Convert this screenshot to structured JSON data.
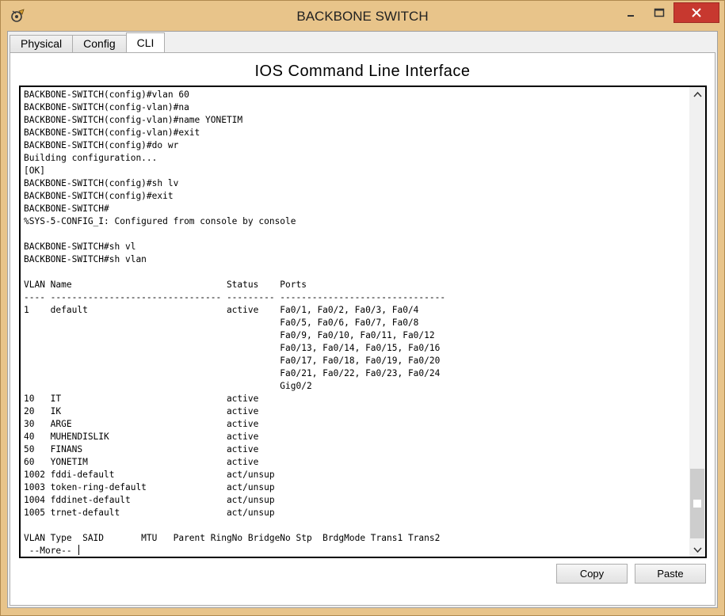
{
  "window": {
    "title": "BACKBONE SWITCH",
    "app_icon": "packet-tracer-icon",
    "controls": [
      "minimize-icon",
      "maximize-icon",
      "close-icon"
    ]
  },
  "tabs": [
    {
      "label": "Physical",
      "active": false
    },
    {
      "label": "Config",
      "active": false
    },
    {
      "label": "CLI",
      "active": true
    }
  ],
  "cli": {
    "heading": "IOS Command Line Interface",
    "lines": [
      "BACKBONE-SWITCH(config)#vlan 60",
      "BACKBONE-SWITCH(config-vlan)#na",
      "BACKBONE-SWITCH(config-vlan)#name YONETIM",
      "BACKBONE-SWITCH(config-vlan)#exit",
      "BACKBONE-SWITCH(config)#do wr",
      "Building configuration...",
      "[OK]",
      "BACKBONE-SWITCH(config)#sh lv",
      "BACKBONE-SWITCH(config)#exit",
      "BACKBONE-SWITCH#",
      "%SYS-5-CONFIG_I: Configured from console by console",
      "",
      "BACKBONE-SWITCH#sh vl",
      "BACKBONE-SWITCH#sh vlan",
      "",
      "VLAN Name                             Status    Ports",
      "---- -------------------------------- --------- -------------------------------",
      "1    default                          active    Fa0/1, Fa0/2, Fa0/3, Fa0/4",
      "                                                Fa0/5, Fa0/6, Fa0/7, Fa0/8",
      "                                                Fa0/9, Fa0/10, Fa0/11, Fa0/12",
      "                                                Fa0/13, Fa0/14, Fa0/15, Fa0/16",
      "                                                Fa0/17, Fa0/18, Fa0/19, Fa0/20",
      "                                                Fa0/21, Fa0/22, Fa0/23, Fa0/24",
      "                                                Gig0/2",
      "10   IT                               active",
      "20   IK                               active",
      "30   ARGE                             active",
      "40   MUHENDISLIK                      active",
      "50   FINANS                           active",
      "60   YONETIM                          active",
      "1002 fddi-default                     act/unsup",
      "1003 token-ring-default               act/unsup",
      "1004 fddinet-default                  act/unsup",
      "1005 trnet-default                    act/unsup",
      "",
      "VLAN Type  SAID       MTU   Parent RingNo BridgeNo Stp  BrdgMode Trans1 Trans2",
      " --More-- "
    ],
    "scroll_position": 0.95
  },
  "buttons": {
    "copy": "Copy",
    "paste": "Paste"
  },
  "colors": {
    "frame": "#e8c48a",
    "close_button": "#c7382f"
  }
}
